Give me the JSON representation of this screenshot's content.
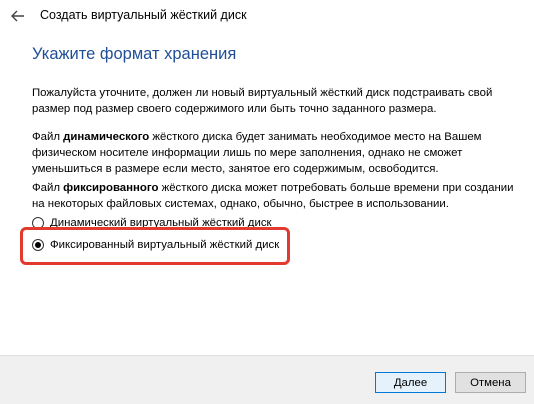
{
  "window": {
    "title": "Создать виртуальный жёсткий диск"
  },
  "page": {
    "heading": "Укажите формат хранения",
    "para1": "Пожалуйста уточните, должен ли новый виртуальный жёсткий диск подстраивать свой размер под размер своего содержимого или быть точно заданного размера.",
    "para2_before": "Файл ",
    "para2_bold": "динамического",
    "para2_after": " жёсткого диска будет занимать необходимое место на Вашем физическом носителе информации лишь по мере заполнения, однако не сможет уменьшиться в размере если место, занятое его содержимым, освободится.",
    "para3_before": "Файл ",
    "para3_bold": "фиксированного",
    "para3_after": " жёсткого диска может потребовать больше времени при создании на некоторых файловых системах, однако, обычно, быстрее в использовании."
  },
  "options": [
    {
      "label": "Динамический виртуальный жёсткий диск",
      "checked": false
    },
    {
      "label": "Фиксированный виртуальный жёсткий диск",
      "checked": true
    }
  ],
  "buttons": {
    "next": "Далее",
    "cancel": "Отмена"
  },
  "colors": {
    "heading": "#1f4e96",
    "highlight": "#e23a2f",
    "primary_border": "#0078d7"
  }
}
